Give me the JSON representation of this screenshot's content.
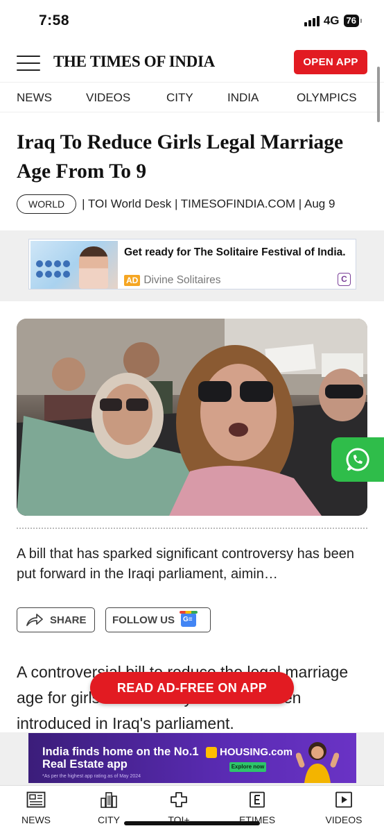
{
  "status_bar": {
    "time": "7:58",
    "network": "4G",
    "battery": "76"
  },
  "header": {
    "logo": "THE TIMES OF INDIA",
    "open_app_label": "OPEN APP"
  },
  "nav": {
    "items": [
      "NEWS",
      "VIDEOS",
      "CITY",
      "INDIA",
      "OLYMPICS"
    ]
  },
  "article": {
    "headline": "Iraq To Reduce Girls Legal Marriage Age From To 9",
    "section_tag": "WORLD",
    "byline": "| TOI World Desk | TIMESOFINDIA.COM | Aug 9",
    "summary": "A bill that has sparked significant controversy has been put forward in the Iraqi parliament, aimin…",
    "body_text": "A controversial bill to reduce the legal marriage age for girls to 9 and boys to 5 has been introduced in Iraq's parliament."
  },
  "top_ad": {
    "title": "Get ready for The Solitaire Festival of India.",
    "ad_tag": "AD",
    "sponsor": "Divine Solitaires",
    "choice_icon": "C"
  },
  "actions": {
    "share_label": "SHARE",
    "follow_label": "FOLLOW US"
  },
  "read_adfree_label": "READ AD-FREE ON APP",
  "bottom_ad": {
    "headline": "India finds home on the No.1 Real Estate app",
    "brand": "HOUSING.com",
    "cta": "Explore now",
    "note": "*As per the highest app rating as of May 2024"
  },
  "tabbar": {
    "items": [
      {
        "label": "NEWS",
        "icon": "newspaper-icon"
      },
      {
        "label": "CITY",
        "icon": "city-buildings-icon"
      },
      {
        "label": "TOI+",
        "icon": "toi-plus-icon"
      },
      {
        "label": "ETIMES",
        "icon": "etimes-icon"
      },
      {
        "label": "VIDEOS",
        "icon": "video-play-icon"
      }
    ]
  },
  "colors": {
    "brand_red": "#e21b22",
    "whatsapp_green": "#2fbd4a",
    "housing_purple": "#5a2bb3"
  }
}
